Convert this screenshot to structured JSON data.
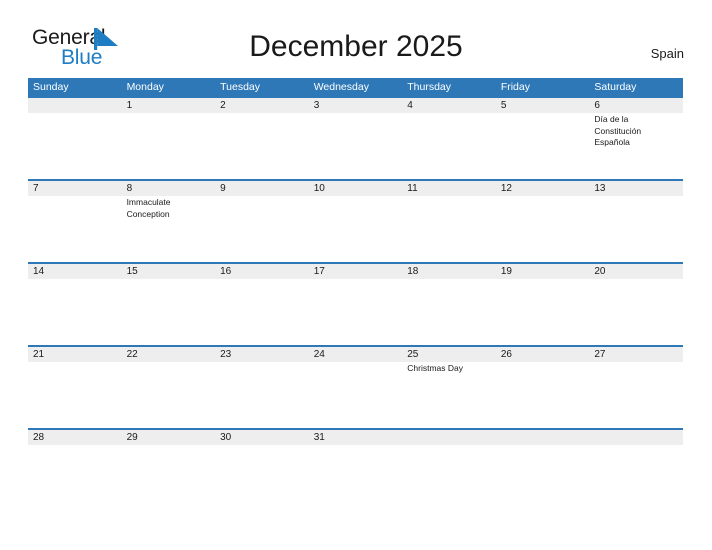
{
  "brand": {
    "word_one": "General",
    "word_two": "Blue",
    "flag_icon": "blue-sail-triangle",
    "dark_color": "#1a1a1a",
    "blue_color": "#1f7dc4"
  },
  "header": {
    "title": "December 2025",
    "country": "Spain"
  },
  "theme": {
    "header_blue": "#2f78b8",
    "row_band_gray": "#eeeeee",
    "text_dark": "#1a1a1a",
    "page_background": "#ffffff"
  },
  "calendar": {
    "day_headers": [
      "Sunday",
      "Monday",
      "Tuesday",
      "Wednesday",
      "Thursday",
      "Friday",
      "Saturday"
    ],
    "weeks": [
      {
        "days": [
          {
            "date": "",
            "events": []
          },
          {
            "date": "1",
            "events": []
          },
          {
            "date": "2",
            "events": []
          },
          {
            "date": "3",
            "events": []
          },
          {
            "date": "4",
            "events": []
          },
          {
            "date": "5",
            "events": []
          },
          {
            "date": "6",
            "events": [
              "Día de la",
              "Constitución",
              "Española"
            ]
          }
        ]
      },
      {
        "days": [
          {
            "date": "7",
            "events": []
          },
          {
            "date": "8",
            "events": [
              "Immaculate",
              "Conception"
            ]
          },
          {
            "date": "9",
            "events": []
          },
          {
            "date": "10",
            "events": []
          },
          {
            "date": "11",
            "events": []
          },
          {
            "date": "12",
            "events": []
          },
          {
            "date": "13",
            "events": []
          }
        ]
      },
      {
        "days": [
          {
            "date": "14",
            "events": []
          },
          {
            "date": "15",
            "events": []
          },
          {
            "date": "16",
            "events": []
          },
          {
            "date": "17",
            "events": []
          },
          {
            "date": "18",
            "events": []
          },
          {
            "date": "19",
            "events": []
          },
          {
            "date": "20",
            "events": []
          }
        ]
      },
      {
        "days": [
          {
            "date": "21",
            "events": []
          },
          {
            "date": "22",
            "events": []
          },
          {
            "date": "23",
            "events": []
          },
          {
            "date": "24",
            "events": []
          },
          {
            "date": "25",
            "events": [
              "Christmas Day"
            ]
          },
          {
            "date": "26",
            "events": []
          },
          {
            "date": "27",
            "events": []
          }
        ]
      },
      {
        "days": [
          {
            "date": "28",
            "events": []
          },
          {
            "date": "29",
            "events": []
          },
          {
            "date": "30",
            "events": []
          },
          {
            "date": "31",
            "events": []
          },
          {
            "date": "",
            "events": []
          },
          {
            "date": "",
            "events": []
          },
          {
            "date": "",
            "events": []
          }
        ]
      }
    ]
  }
}
